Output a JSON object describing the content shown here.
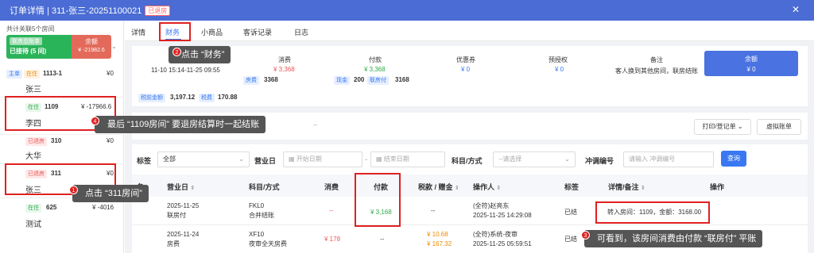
{
  "title": {
    "text": "订单详情 | 311-张三-20251100021",
    "badge": "已退房"
  },
  "tabs": [
    "详情",
    "财务",
    "小商品",
    "客诉记录",
    "日志"
  ],
  "left": {
    "summary": "共计关联5个房间",
    "total_label": "联房总账单",
    "status": "已接待 (5 间)",
    "balance_label": "余额",
    "balance_value": "¥ -21982.6",
    "rooms": [
      {
        "tag1": "主单",
        "tag2": "在住",
        "room": "1113-1",
        "amount": "¥0",
        "name": "张三"
      },
      {
        "tag1": "在住",
        "room": "1109",
        "amount": "¥ -17966.6",
        "name": "李四"
      },
      {
        "tag1": "已退房",
        "room": "310",
        "amount": "¥0",
        "name": "大华"
      },
      {
        "tag1": "已退房",
        "room": "311",
        "amount": "¥0",
        "name": "张三"
      },
      {
        "tag1": "在住",
        "room": "625",
        "amount": "¥ -4016",
        "name": "测试"
      }
    ]
  },
  "summary": {
    "checkin_label": "入离",
    "checkin_time": "11-10 15:14-11-25 09:55",
    "consume_label": "消费",
    "consume_value": "¥ 3,368",
    "consume_tag": "房费",
    "consume_tag_value": "3368",
    "pay_label": "付款",
    "pay_value": "¥ 3,368",
    "pay_tag1": "现金",
    "pay_tag1_value": "200",
    "pay_tag2": "联房付",
    "pay_tag2_value": "3168",
    "coupon_label": "优惠券",
    "coupon_value": "¥ 0",
    "preauth_label": "预授权",
    "preauth_value": "¥ 0",
    "remark_label": "备注",
    "remark_value": "客人换到其他房间，联房结账",
    "balance_label": "余额",
    "balance_value": "¥ 0",
    "pretax_label": "税前金额",
    "pretax_value": "3,197.12",
    "tax_label": "税费",
    "tax_value": "170.88"
  },
  "toolbar": {
    "print": "打印/登记单",
    "virtual": "虚拟账单",
    "dash": "--"
  },
  "filters": {
    "tag_label": "标签",
    "tag_value": "全部",
    "bizdate_label": "营业日",
    "start_ph": "开始日期",
    "end_ph": "结束日期",
    "subject_label": "科目/方式",
    "subject_ph": "--请选择",
    "offset_label": "冲调编号",
    "offset_ph": "请输入 冲调编号",
    "query": "查询"
  },
  "table": {
    "headers": [
      "营业日",
      "科目/方式",
      "消费",
      "付款",
      "税款 / 赠金",
      "操作人",
      "标签",
      "详情/备注",
      "操作"
    ],
    "rows": [
      {
        "date": "2025-11-25",
        "type": "联房付",
        "subject": "FKL0",
        "method": "合并结账",
        "consume": "--",
        "pay": "¥ 3,168",
        "tax": "--",
        "operator": "(全符)赵亮东",
        "optime": "2025-11-25 14:29:08",
        "tag": "已结",
        "detail": "转入房间：1109，金额：3168.00"
      },
      {
        "date": "2025-11-24",
        "type": "房费",
        "subject": "XF10",
        "method": "夜审全天房费",
        "consume": "¥ 178",
        "pay": "--",
        "tax": "¥ 10.68",
        "tax2": "¥ 167.32",
        "operator": "(全符)系统-夜审",
        "optime": "2025-11-25 05:59:51",
        "tag": "已结",
        "detail": ""
      }
    ]
  },
  "callouts": [
    {
      "n": "2",
      "text": "点击 “财务”"
    },
    {
      "n": "4",
      "text": "最后 “1109房间” 要退房结算时一起结账"
    },
    {
      "n": "1",
      "text": "点击 “311房间”"
    },
    {
      "n": "3",
      "text": "可看到，该房间消费由付款 “联房付” 平账"
    }
  ]
}
